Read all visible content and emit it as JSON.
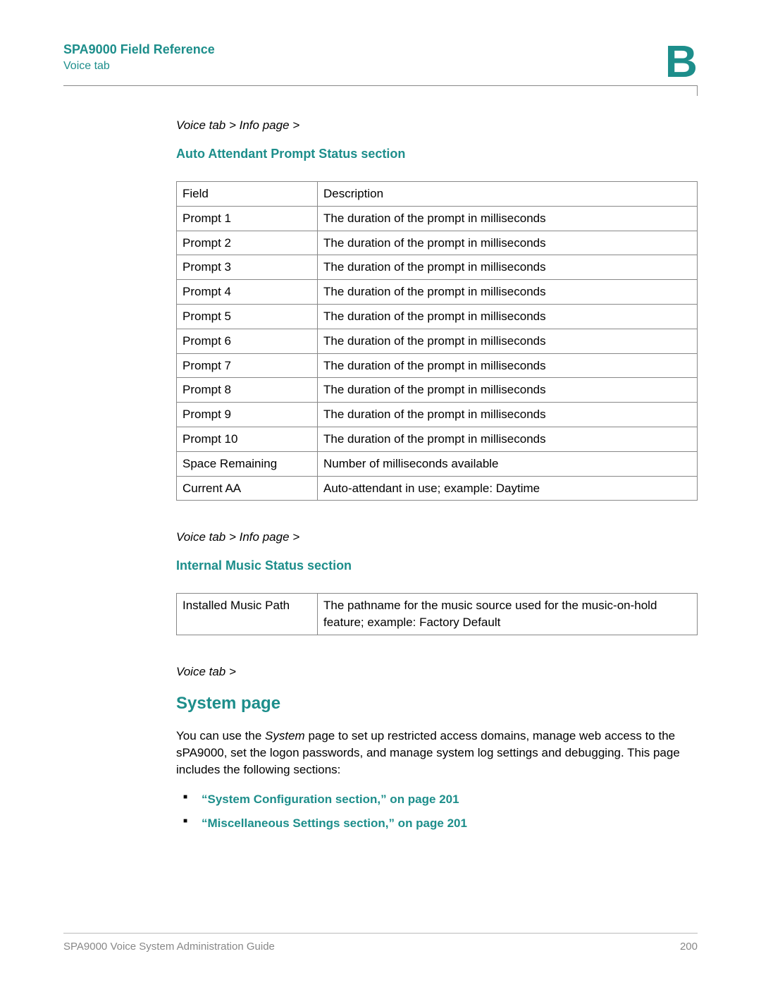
{
  "header": {
    "title": "SPA9000 Field Reference",
    "subtitle": "Voice tab",
    "appendix": "B"
  },
  "section1": {
    "breadcrumb": "Voice tab > Info page >",
    "heading": "Auto Attendant Prompt Status section",
    "cols": {
      "c1": "Field",
      "c2": "Description"
    },
    "rows": [
      {
        "f": "Prompt 1",
        "d": "The duration of the prompt in milliseconds"
      },
      {
        "f": "Prompt 2",
        "d": "The duration of the prompt in milliseconds"
      },
      {
        "f": "Prompt 3",
        "d": "The duration of the prompt in milliseconds"
      },
      {
        "f": "Prompt 4",
        "d": "The duration of the prompt in milliseconds"
      },
      {
        "f": "Prompt 5",
        "d": "The duration of the prompt in milliseconds"
      },
      {
        "f": "Prompt 6",
        "d": "The duration of the prompt in milliseconds"
      },
      {
        "f": "Prompt 7",
        "d": "The duration of the prompt in milliseconds"
      },
      {
        "f": "Prompt 8",
        "d": "The duration of the prompt in milliseconds"
      },
      {
        "f": "Prompt 9",
        "d": "The duration of the prompt in milliseconds"
      },
      {
        "f": "Prompt 10",
        "d": "The duration of the prompt in milliseconds"
      },
      {
        "f": "Space Remaining",
        "d": "Number of milliseconds available"
      },
      {
        "f": "Current AA",
        "d": "Auto-attendant in use; example: Daytime"
      }
    ]
  },
  "section2": {
    "breadcrumb": "Voice tab > Info page >",
    "heading": "Internal Music Status section",
    "rows": [
      {
        "f": "Installed Music Path",
        "d": "The pathname for the music source used for the music-on-hold feature; example: Factory Default"
      }
    ]
  },
  "section3": {
    "breadcrumb": "Voice tab >",
    "heading": "System page",
    "body_pre": "You can use the ",
    "body_em": "System",
    "body_post": " page to set up restricted access domains, manage web access to the sPA9000, set the logon passwords, and manage system log settings and debugging. This page includes the following sections:",
    "links": [
      "“System Configuration section,” on page 201",
      "“Miscellaneous Settings section,” on page 201"
    ]
  },
  "footer": {
    "text": "SPA9000 Voice System Administration Guide",
    "page": "200"
  }
}
